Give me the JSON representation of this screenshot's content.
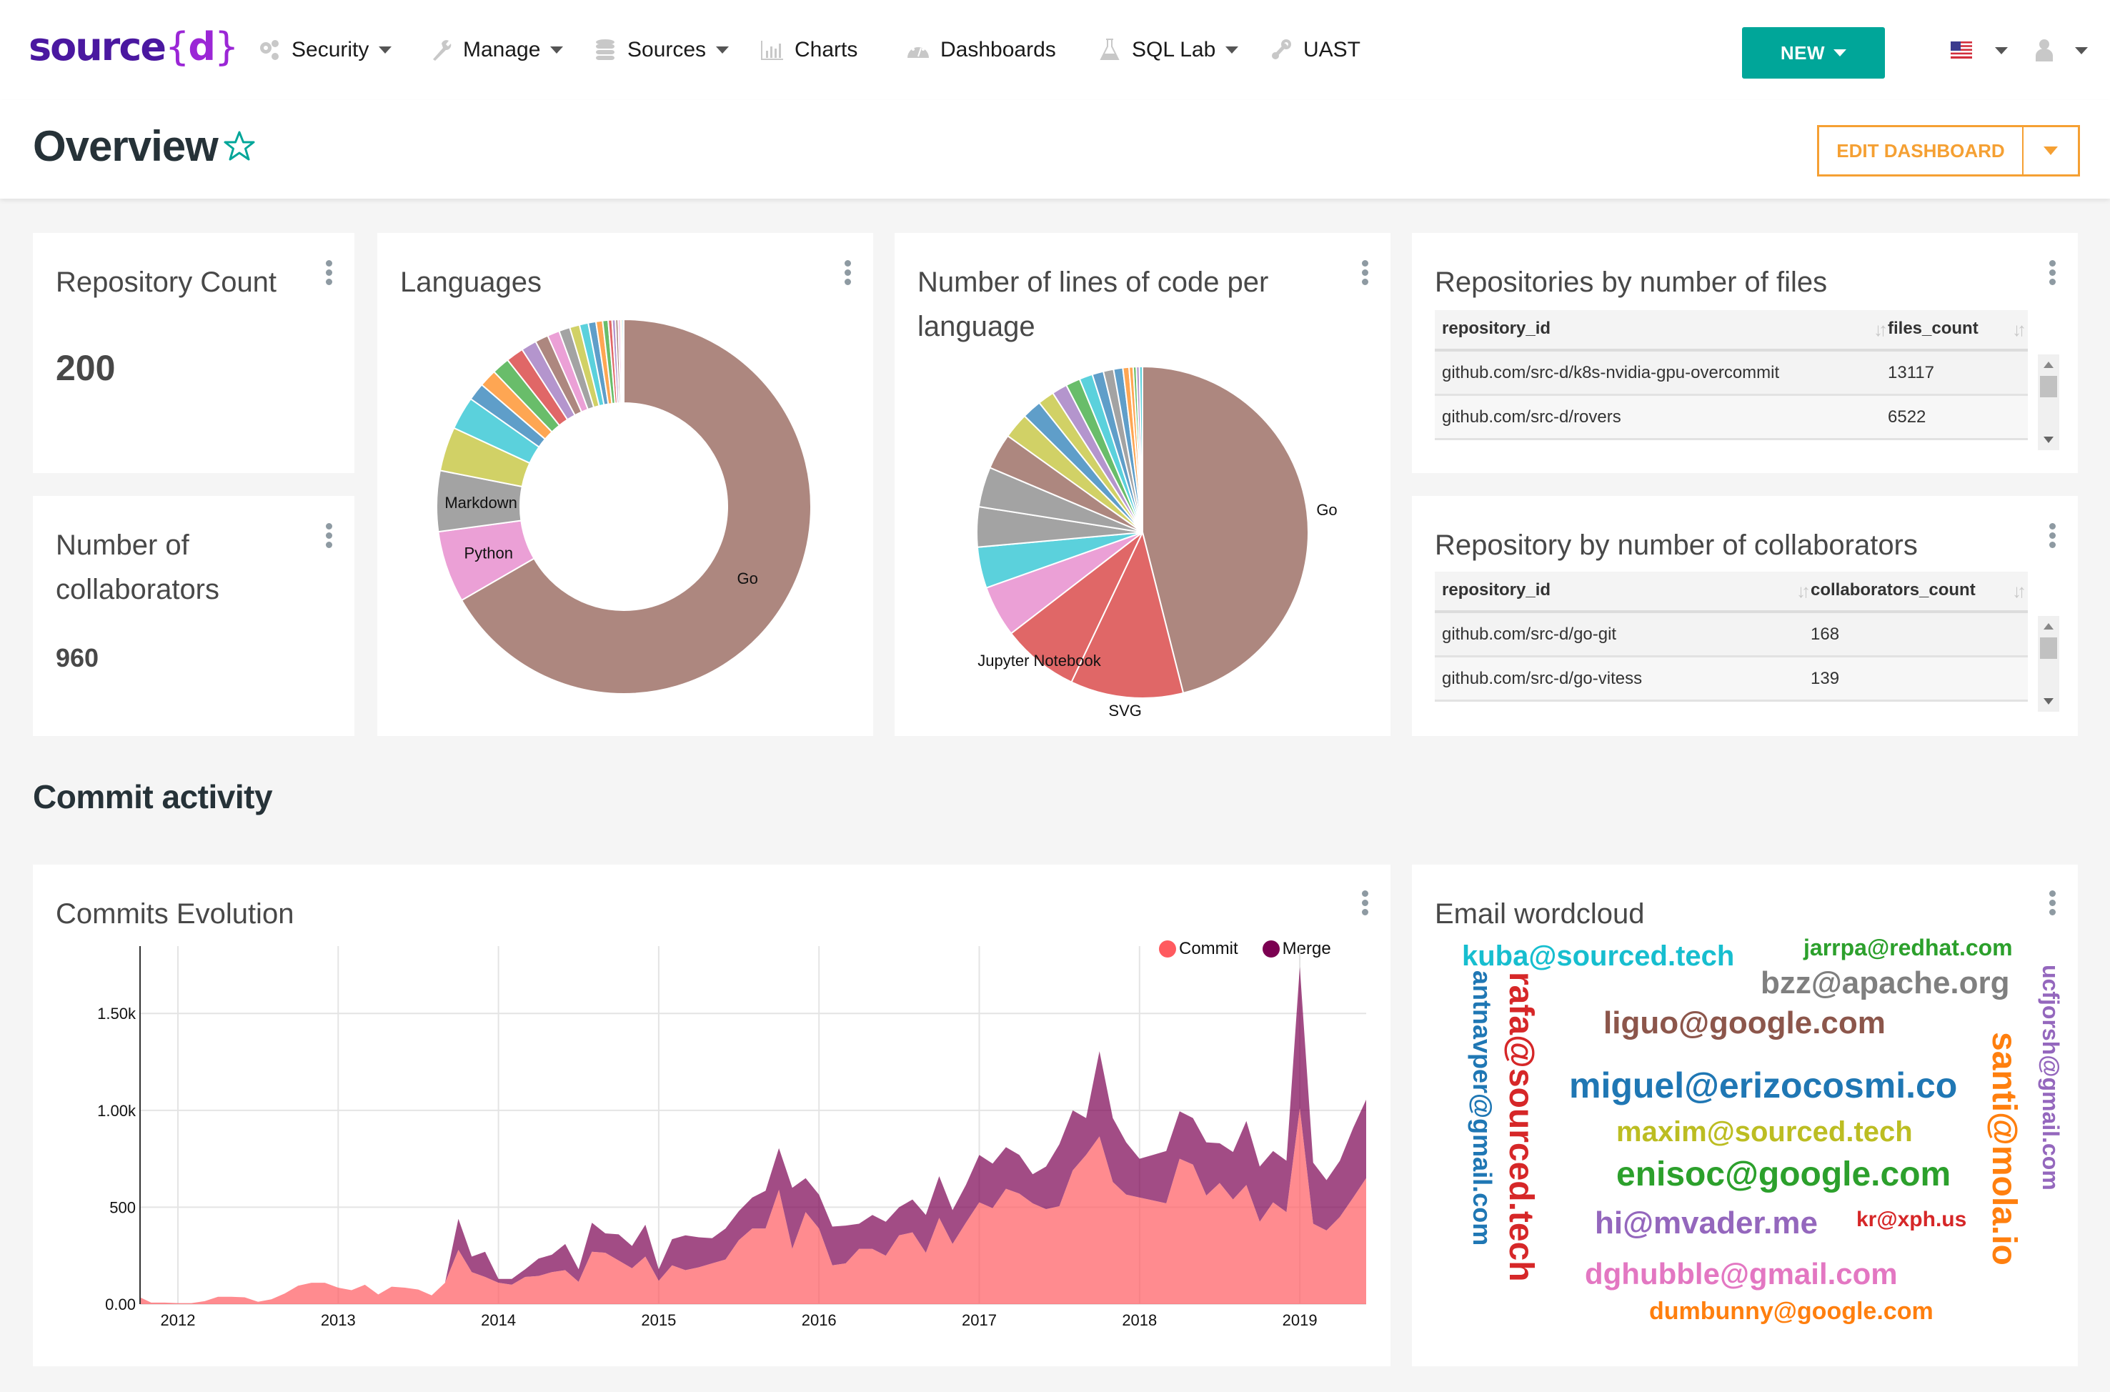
{
  "navbar": {
    "logo_main": "source",
    "logo_brace_open": "{",
    "logo_brace_letter": "d",
    "logo_brace_close": "}",
    "items": [
      {
        "label": "Security",
        "icon": "gears-icon",
        "has_dropdown": true
      },
      {
        "label": "Manage",
        "icon": "wrench-icon",
        "has_dropdown": true
      },
      {
        "label": "Sources",
        "icon": "database-icon",
        "has_dropdown": true
      },
      {
        "label": "Charts",
        "icon": "bar-chart-icon",
        "has_dropdown": false
      },
      {
        "label": "Dashboards",
        "icon": "dashboard-icon",
        "has_dropdown": false
      },
      {
        "label": "SQL Lab",
        "icon": "flask-icon",
        "has_dropdown": true
      },
      {
        "label": "UAST",
        "icon": "steam-icon",
        "has_dropdown": false
      }
    ],
    "new_button": "NEW",
    "language": "us-flag-icon",
    "user": "user-icon"
  },
  "header": {
    "title": "Overview",
    "favorite_icon": "star-outline-icon",
    "edit_button": "EDIT DASHBOARD"
  },
  "colors": {
    "accent": "#00a699",
    "edit_orange": "#f5a033",
    "title_dark": "#263238",
    "logo_purple": "#4a18a0",
    "logo_brace": "#9b26d6",
    "commit": "#ff5a5f",
    "merge": "#7b0051"
  },
  "cards": {
    "repo_count": {
      "title": "Repository Count",
      "value": "200"
    },
    "collaborators": {
      "title_line1": "Number of",
      "title_line2": "collaborators",
      "value": "960"
    },
    "languages": {
      "title": "Languages"
    },
    "loc": {
      "title_line1": "Number of lines of code per",
      "title_line2": "language"
    },
    "files_table": {
      "title": "Repositories by number of files",
      "columns": [
        "repository_id",
        "files_count"
      ],
      "rows": [
        [
          "github.com/src-d/k8s-nvidia-gpu-overcommit",
          "13117"
        ],
        [
          "github.com/src-d/rovers",
          "6522"
        ]
      ]
    },
    "collab_table": {
      "title": "Repository by number of collaborators",
      "columns": [
        "repository_id",
        "collaborators_count"
      ],
      "rows": [
        [
          "github.com/src-d/go-git",
          "168"
        ],
        [
          "github.com/src-d/go-vitess",
          "139"
        ]
      ]
    },
    "commits": {
      "title": "Commits Evolution"
    },
    "wordcloud": {
      "title": "Email wordcloud",
      "words": [
        {
          "text": "kuba@sourced.tech",
          "color": "#17becf"
        },
        {
          "text": "jarrpa@redhat.com",
          "color": "#2ca02c"
        },
        {
          "text": "bzz@apache.org",
          "color": "#7f7f7f"
        },
        {
          "text": "liguo@google.com",
          "color": "#8c564b"
        },
        {
          "text": "miguel@erizocosmi.co",
          "color": "#1f77b4"
        },
        {
          "text": "maxim@sourced.tech",
          "color": "#bcbd22"
        },
        {
          "text": "enisoc@google.com",
          "color": "#2ca02c"
        },
        {
          "text": "hi@mvader.me",
          "color": "#9467bd"
        },
        {
          "text": "kr@xph.us",
          "color": "#d62728"
        },
        {
          "text": "dghubble@gmail.com",
          "color": "#e377c2"
        },
        {
          "text": "dumbunny@google.com",
          "color": "#ff7f0e"
        },
        {
          "text": "antnavper@gmail.com",
          "color": "#1f77b4"
        },
        {
          "text": "rafa@sourced.tech",
          "color": "#d62728"
        },
        {
          "text": "santi@mola.io",
          "color": "#ff7f0e"
        },
        {
          "text": "ucfjorsh@gmail.com",
          "color": "#9467bd"
        }
      ]
    }
  },
  "section": {
    "commit_activity": "Commit activity"
  },
  "chart_data": [
    {
      "type": "pie",
      "variant": "donut",
      "title": "Languages",
      "labels": [
        "Go",
        "Python",
        "Markdown",
        "",
        "",
        "",
        "",
        "",
        "",
        "",
        "",
        "",
        "",
        "",
        "",
        "",
        "",
        "",
        "",
        "",
        "",
        "",
        "",
        ""
      ],
      "values": [
        70.0,
        6.5,
        5.5,
        4.0,
        3.0,
        1.6,
        1.6,
        1.6,
        1.6,
        1.4,
        1.2,
        1.1,
        1.0,
        0.9,
        0.8,
        0.7,
        0.6,
        0.5,
        0.35,
        0.3,
        0.25,
        0.2,
        0.15,
        0.15
      ],
      "colors": [
        "#ad877f",
        "#eba0d6",
        "#a3a3a3",
        "#d1d166",
        "#5bd1dc",
        "#5f9ec9",
        "#fea653",
        "#69bd6a",
        "#e06767",
        "#b495cd",
        "#ad877f",
        "#eba0d6",
        "#a3a3a3",
        "#d1d166",
        "#5bd1dc",
        "#5f9ec9",
        "#fea653",
        "#69bd6a",
        "#e06767",
        "#b495cd",
        "#ad877f",
        "#eba0d6",
        "#d1d166",
        "#5bd1dc"
      ],
      "label_slices": [
        "Go",
        "Python",
        "Markdown"
      ]
    },
    {
      "type": "pie",
      "title": "Number of lines of code per language",
      "labels": [
        "Go",
        "SVG",
        "Jupyter Notebook",
        "",
        "",
        "",
        "",
        "",
        "",
        "",
        "",
        "",
        "",
        "",
        "",
        "",
        "",
        "",
        "",
        "",
        "",
        ""
      ],
      "values": [
        46.0,
        11.0,
        7.5,
        5.0,
        4.0,
        3.9,
        3.9,
        3.5,
        2.5,
        1.9,
        1.6,
        1.5,
        1.4,
        1.3,
        1.1,
        1.0,
        0.9,
        0.6,
        0.4,
        0.3,
        0.3,
        0.3
      ],
      "colors": [
        "#ad877f",
        "#e06767",
        "#e06767",
        "#eba0d6",
        "#5bd1dc",
        "#a3a3a3",
        "#a3a3a3",
        "#ad877f",
        "#d1d166",
        "#5f9ec9",
        "#d1d166",
        "#b495cd",
        "#69bd6a",
        "#5bd1dc",
        "#5f9ec9",
        "#a3a3a3",
        "#5f9ec9",
        "#fea653",
        "#fea653",
        "#69bd6a",
        "#b495cd",
        "#5bd1dc"
      ],
      "label_slices": [
        "Go",
        "SVG",
        "Jupyter Notebook"
      ]
    },
    {
      "type": "area",
      "stacked": true,
      "title": "Commits Evolution",
      "x_start": "2011-10",
      "x_step": "month",
      "xticks": [
        "2012",
        "2013",
        "2014",
        "2015",
        "2016",
        "2017",
        "2018",
        "2019"
      ],
      "yticks": [
        "0.00",
        "500",
        "1.00k",
        "1.50k"
      ],
      "ylim": [
        0,
        1700
      ],
      "grid": true,
      "legend": {
        "position": "top-right",
        "entries": [
          "Commit",
          "Merge"
        ]
      },
      "series": [
        {
          "name": "Commit",
          "color": "#ff5a5f",
          "values": [
            35,
            8,
            8,
            5,
            5,
            15,
            38,
            38,
            35,
            12,
            25,
            55,
            95,
            110,
            110,
            85,
            72,
            100,
            50,
            90,
            85,
            75,
            45,
            110,
            280,
            165,
            140,
            110,
            100,
            140,
            145,
            165,
            175,
            115,
            270,
            265,
            225,
            185,
            245,
            120,
            200,
            175,
            190,
            210,
            230,
            330,
            390,
            390,
            590,
            285,
            475,
            390,
            200,
            210,
            285,
            285,
            250,
            355,
            370,
            265,
            445,
            310,
            420,
            525,
            495,
            595,
            570,
            520,
            490,
            505,
            690,
            770,
            865,
            630,
            565,
            550,
            535,
            520,
            750,
            720,
            560,
            625,
            540,
            615,
            425,
            525,
            475,
            1010,
            415,
            380,
            450,
            550,
            650,
            570,
            765,
            610
          ]
        },
        {
          "name": "Merge",
          "color": "#7b0051",
          "values": [
            0,
            0,
            0,
            0,
            0,
            0,
            0,
            0,
            0,
            0,
            0,
            0,
            0,
            0,
            0,
            0,
            0,
            0,
            0,
            0,
            0,
            0,
            0,
            0,
            160,
            80,
            130,
            20,
            30,
            40,
            90,
            90,
            135,
            65,
            150,
            100,
            135,
            115,
            165,
            60,
            135,
            180,
            155,
            130,
            160,
            150,
            160,
            195,
            215,
            315,
            175,
            175,
            200,
            195,
            130,
            175,
            175,
            145,
            170,
            195,
            215,
            175,
            195,
            245,
            230,
            215,
            200,
            150,
            220,
            320,
            310,
            190,
            440,
            330,
            270,
            200,
            235,
            270,
            245,
            240,
            275,
            205,
            245,
            330,
            285,
            265,
            265,
            730,
            315,
            260,
            290,
            360,
            405,
            430,
            620,
            545
          ]
        }
      ]
    }
  ]
}
